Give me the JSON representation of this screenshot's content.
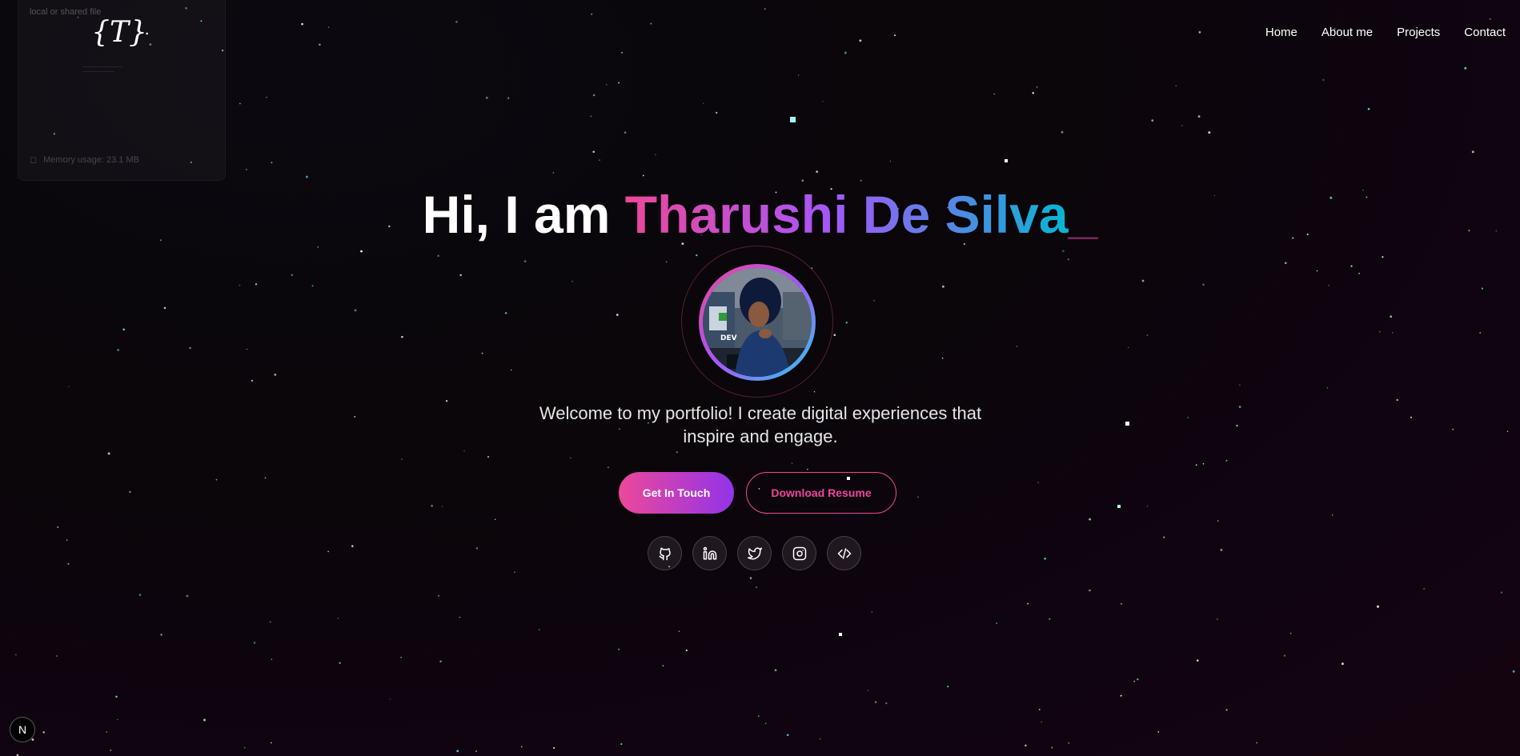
{
  "overlay": {
    "top_text": "local or shared file",
    "memory_text": "Memory usage: 23.1 MB"
  },
  "logo": {
    "text": "{T}"
  },
  "nav": {
    "items": [
      "Home",
      "About me",
      "Projects",
      "Contact"
    ]
  },
  "hero": {
    "greeting": "Hi, I am ",
    "name": "Tharushi De Silva",
    "cursor": "_",
    "tagline": "Welcome to my portfolio! I create digital experiences that inspire and engage."
  },
  "buttons": {
    "primary": "Get In Touch",
    "secondary": "Download Resume"
  },
  "socials": [
    {
      "name": "github-icon"
    },
    {
      "name": "linkedin-icon"
    },
    {
      "name": "twitter-icon"
    },
    {
      "name": "instagram-icon"
    },
    {
      "name": "code-icon"
    }
  ],
  "dev_badge": "N",
  "colors": {
    "accent_pink": "#ec4899",
    "accent_purple": "#a855f7",
    "accent_cyan": "#06b6d4"
  }
}
